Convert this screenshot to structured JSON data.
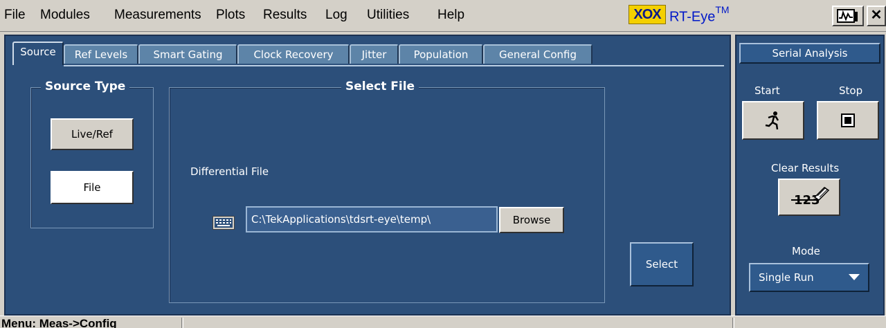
{
  "menu": {
    "items": [
      "File",
      "Modules",
      "Measurements",
      "Plots",
      "Results",
      "Log",
      "Utilities",
      "Help"
    ]
  },
  "app": {
    "logo_text": "XOX",
    "title": "RT-Eye",
    "title_sup": "TM",
    "close_label": "✕"
  },
  "tabs": [
    "Source",
    "Ref Levels",
    "Smart Gating",
    "Clock Recovery",
    "Jitter",
    "Population",
    "General Config"
  ],
  "source_type": {
    "title": "Source Type",
    "live_ref_label": "Live/Ref",
    "file_label": "File"
  },
  "select_file": {
    "title": "Select File",
    "differential_label": "Differential File",
    "path_value": "C:\\TekApplications\\tdsrt-eye\\temp\\",
    "browse_label": "Browse"
  },
  "select_button_label": "Select",
  "right_panel": {
    "serial_analysis_label": "Serial Analysis",
    "start_label": "Start",
    "stop_label": "Stop",
    "clear_results_label": "Clear Results",
    "clear_icon_text": "123",
    "mode_label": "Mode",
    "mode_value": "Single Run"
  },
  "status": {
    "text": "Menu: Meas->Config"
  },
  "icons": {
    "keyboard": "keyboard-icon",
    "start": "running-man-icon",
    "stop": "stop-square-icon",
    "clear": "eraser-icon",
    "scope": "oscilloscope-icon"
  },
  "colors": {
    "panel": "#2c4f7a",
    "tab": "#5d84a8",
    "logo": "#f4d000",
    "title": "#0018c8"
  }
}
